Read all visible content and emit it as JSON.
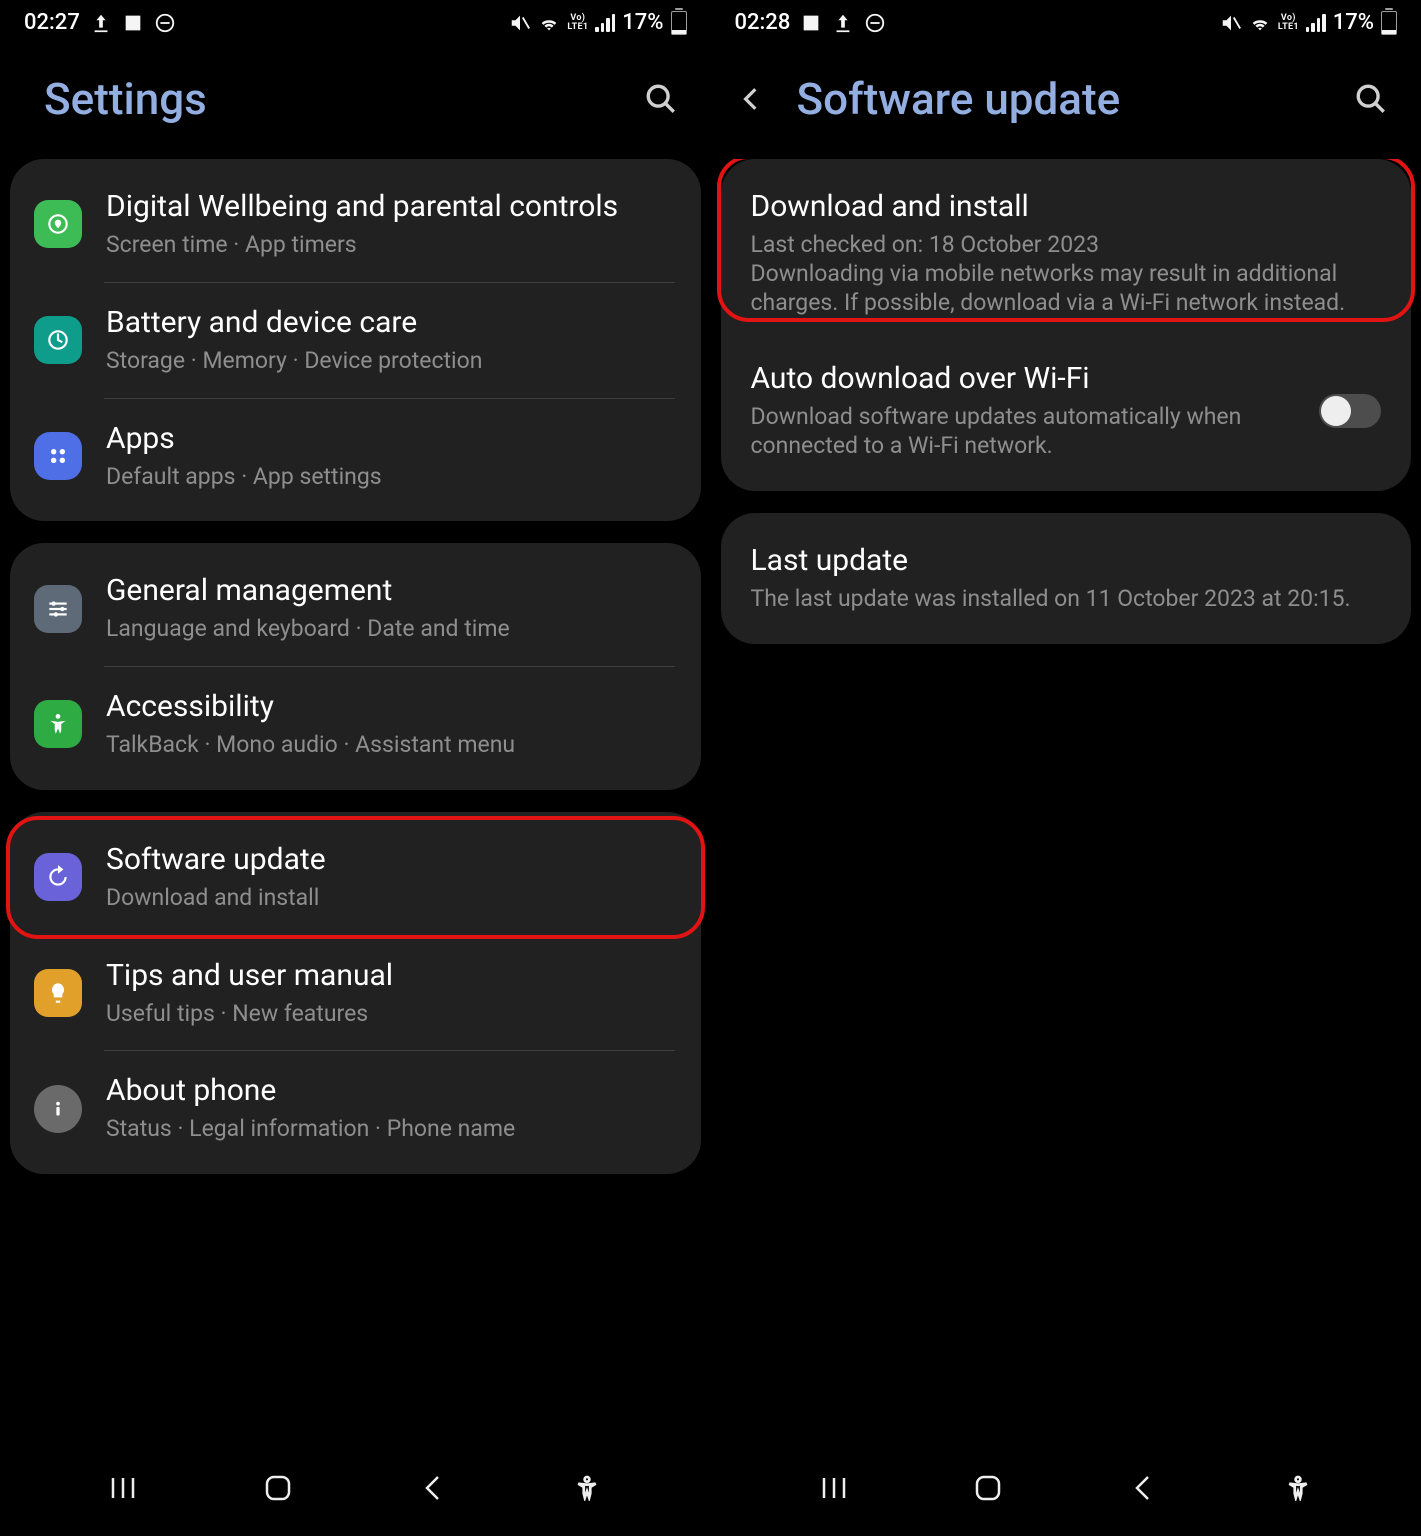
{
  "left": {
    "status": {
      "time": "02:27",
      "battery_text": "17%"
    },
    "header": {
      "title": "Settings"
    },
    "groups": [
      {
        "items": [
          {
            "title": "Digital Wellbeing and parental controls",
            "sub": "Screen time  ·  App timers"
          },
          {
            "title": "Battery and device care",
            "sub": "Storage  ·  Memory  ·  Device protection"
          },
          {
            "title": "Apps",
            "sub": "Default apps  ·  App settings"
          }
        ]
      },
      {
        "items": [
          {
            "title": "General management",
            "sub": "Language and keyboard  ·  Date and time"
          },
          {
            "title": "Accessibility",
            "sub": "TalkBack  ·  Mono audio  ·  Assistant menu"
          }
        ]
      },
      {
        "items": [
          {
            "title": "Software update",
            "sub": "Download and install"
          },
          {
            "title": "Tips and user manual",
            "sub": "Useful tips  ·  New features"
          },
          {
            "title": "About phone",
            "sub": "Status  ·  Legal information  ·  Phone name"
          }
        ]
      }
    ]
  },
  "right": {
    "status": {
      "time": "02:28",
      "battery_text": "17%"
    },
    "header": {
      "title": "Software update"
    },
    "card1": {
      "download": {
        "title": "Download and install",
        "sub": "Last checked on: 18 October 2023\nDownloading via mobile networks may result in additional charges. If possible, download via a Wi-Fi network instead."
      },
      "auto": {
        "title": "Auto download over Wi-Fi",
        "sub": "Download software updates automatically when connected to a Wi-Fi network."
      }
    },
    "card2": {
      "last": {
        "title": "Last update",
        "sub": "The last update was installed on 11 October 2023 at 20:15."
      }
    }
  }
}
